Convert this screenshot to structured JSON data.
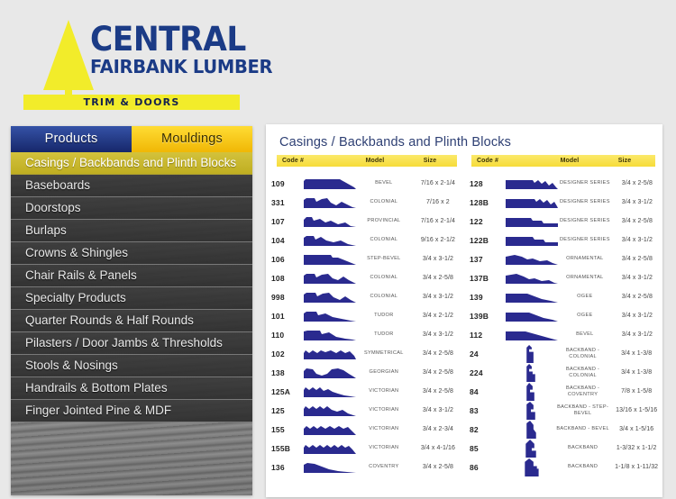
{
  "logo": {
    "line1": "CENTRAL",
    "line2": "FAIRBANK LUMBER",
    "tagline": "TRIM & DOORS",
    "blue": "#1b3b86",
    "yellow": "#f2ec2a"
  },
  "sidebar": {
    "tabs": [
      {
        "label": "Products",
        "active": true,
        "color": "#1b3b86"
      },
      {
        "label": "Mouldings",
        "active": false,
        "color": "#f6c700"
      }
    ],
    "items": [
      {
        "label": "Casings / Backbands and Plinth Blocks",
        "active": true
      },
      {
        "label": "Baseboards",
        "active": false
      },
      {
        "label": "Doorstops",
        "active": false
      },
      {
        "label": "Burlaps",
        "active": false
      },
      {
        "label": "Crowns & Shingles",
        "active": false
      },
      {
        "label": "Chair Rails & Panels",
        "active": false
      },
      {
        "label": "Specialty Products",
        "active": false
      },
      {
        "label": "Quarter Rounds & Half Rounds",
        "active": false
      },
      {
        "label": "Pilasters / Door Jambs & Thresholds",
        "active": false
      },
      {
        "label": "Stools & Nosings",
        "active": false
      },
      {
        "label": "Handrails & Bottom Plates",
        "active": false
      },
      {
        "label": "Finger Jointed Pine & MDF",
        "active": false
      }
    ]
  },
  "content": {
    "title": "Casings / Backbands and Plinth Blocks",
    "title_color": "#2d3f73",
    "profile_color": "#2a2a8f",
    "header_color": "#f6dc39",
    "columns": [
      "Code #",
      "Model",
      "Size"
    ],
    "left_table": [
      {
        "code": "109",
        "model": "BEVEL",
        "size": "7/16 x 2-1/4",
        "shape": "p109"
      },
      {
        "code": "331",
        "model": "COLONIAL",
        "size": "7/16 x 2",
        "shape": "p331"
      },
      {
        "code": "107",
        "model": "PROVINCIAL",
        "size": "7/16 x 2-1/4",
        "shape": "p107"
      },
      {
        "code": "104",
        "model": "COLONIAL",
        "size": "9/16 x 2-1/2",
        "shape": "p104"
      },
      {
        "code": "106",
        "model": "STEP-BEVEL",
        "size": "3/4 x 3-1/2",
        "shape": "p106"
      },
      {
        "code": "108",
        "model": "COLONIAL",
        "size": "3/4 x 2-5/8",
        "shape": "p108"
      },
      {
        "code": "998",
        "model": "COLONIAL",
        "size": "3/4 x 3-1/2",
        "shape": "p998"
      },
      {
        "code": "101",
        "model": "TUDOR",
        "size": "3/4 x 2-1/2",
        "shape": "p101"
      },
      {
        "code": "110",
        "model": "TUDOR",
        "size": "3/4 x 3-1/2",
        "shape": "p110"
      },
      {
        "code": "102",
        "model": "SYMMETRICAL",
        "size": "3/4 x 2-5/8",
        "shape": "p102"
      },
      {
        "code": "138",
        "model": "GEORGIAN",
        "size": "3/4 x 2-5/8",
        "shape": "p138"
      },
      {
        "code": "125A",
        "model": "VICTORIAN",
        "size": "3/4 x 2-5/8",
        "shape": "p125a"
      },
      {
        "code": "125",
        "model": "VICTORIAN",
        "size": "3/4 x 3-1/2",
        "shape": "p125"
      },
      {
        "code": "155",
        "model": "VICTORIAN",
        "size": "3/4 x 2-3/4",
        "shape": "p155"
      },
      {
        "code": "155B",
        "model": "VICTORIAN",
        "size": "3/4 x 4-1/16",
        "shape": "p155b"
      },
      {
        "code": "136",
        "model": "COVENTRY",
        "size": "3/4 x 2-5/8",
        "shape": "p136"
      }
    ],
    "right_table": [
      {
        "code": "128",
        "model": "DESIGNER SERIES",
        "size": "3/4 x 2-5/8",
        "shape": "r128"
      },
      {
        "code": "128B",
        "model": "DESIGNER SERIES",
        "size": "3/4 x 3-1/2",
        "shape": "r128b"
      },
      {
        "code": "122",
        "model": "DESIGNER SERIES",
        "size": "3/4 x 2-5/8",
        "shape": "r122"
      },
      {
        "code": "122B",
        "model": "DESIGNER SERIES",
        "size": "3/4 x 3-1/2",
        "shape": "r122b"
      },
      {
        "code": "137",
        "model": "ORNAMENTAL",
        "size": "3/4 x 2-5/8",
        "shape": "r137"
      },
      {
        "code": "137B",
        "model": "ORNAMENTAL",
        "size": "3/4 x 3-1/2",
        "shape": "r137b"
      },
      {
        "code": "139",
        "model": "OGEE",
        "size": "3/4 x 2-5/8",
        "shape": "r139"
      },
      {
        "code": "139B",
        "model": "OGEE",
        "size": "3/4 x 3-1/2",
        "shape": "r139b"
      },
      {
        "code": "112",
        "model": "BEVEL",
        "size": "3/4 x 3-1/2",
        "shape": "r112"
      },
      {
        "code": "24",
        "model": "BACKBAND - COLONIAL",
        "size": "3/4 x 1-3/8",
        "shape": "b24"
      },
      {
        "code": "224",
        "model": "BACKBAND - COLONIAL",
        "size": "3/4 x 1-3/8",
        "shape": "b224"
      },
      {
        "code": "84",
        "model": "BACKBAND - COVENTRY",
        "size": "7/8 x 1-5/8",
        "shape": "b84"
      },
      {
        "code": "83",
        "model": "BACKBAND - STEP-BEVEL",
        "size": "13/16 x 1-5/16",
        "shape": "b83"
      },
      {
        "code": "82",
        "model": "BACKBAND - BEVEL",
        "size": "3/4 x 1-5/16",
        "shape": "b82"
      },
      {
        "code": "85",
        "model": "BACKBAND",
        "size": "1-3/32 x 1-1/2",
        "shape": "b85"
      },
      {
        "code": "86",
        "model": "BACKBAND",
        "size": "1-1/8 x 1-11/32",
        "shape": "b86"
      }
    ]
  }
}
